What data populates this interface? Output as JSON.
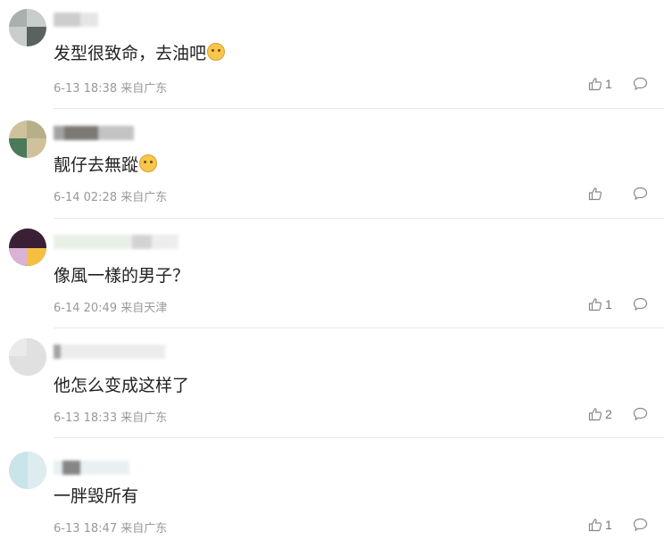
{
  "comments": [
    {
      "text": "发型很致命，去油吧",
      "emoji": "emoji-icon",
      "time": "6-13 18:38",
      "location": "来自广东",
      "likes": "1",
      "avatar_colors": [
        "#9aa2a0",
        "#5a6260",
        "#d2d6d4"
      ],
      "name_colors": [
        "#c8c8c8",
        "#e3e3e3"
      ]
    },
    {
      "text": "靓仔去無蹤",
      "emoji": "laughing-emoji-icon",
      "time": "6-14 02:28",
      "location": "来自广东",
      "likes": "",
      "avatar_colors": [
        "#b6b08a",
        "#4a7a5a",
        "#cfc19b"
      ],
      "name_colors": [
        "#6e6a66",
        "#bdbdbd"
      ]
    },
    {
      "text": "像風一樣的男子？",
      "emoji": "",
      "time": "6-14 20:49",
      "location": "来自天津",
      "likes": "1",
      "avatar_colors": [
        "#3a1f35",
        "#f5c040",
        "#d9b2d6"
      ],
      "name_colors": [
        "#e6efe4",
        "#cfcfcf"
      ]
    },
    {
      "text": "他怎么变成这样了",
      "emoji": "",
      "time": "6-13 18:33",
      "location": "来自广东",
      "likes": "2",
      "avatar_colors": [
        "#e0e0e0",
        "#eaeaea",
        "#d6d6d6"
      ],
      "name_colors": [
        "#ebebeb",
        "#dedede"
      ]
    },
    {
      "text": "一胖毁所有",
      "emoji": "",
      "time": "6-13 18:47",
      "location": "来自广东",
      "likes": "1",
      "avatar_colors": [
        "#c9e4ea",
        "#b7d9e1",
        "#dcecef"
      ],
      "name_colors": [
        "#7a7a7a",
        "#e4eef0"
      ]
    }
  ],
  "icons": {
    "like": "thumbs-up-icon",
    "reply": "comment-bubble-icon"
  }
}
